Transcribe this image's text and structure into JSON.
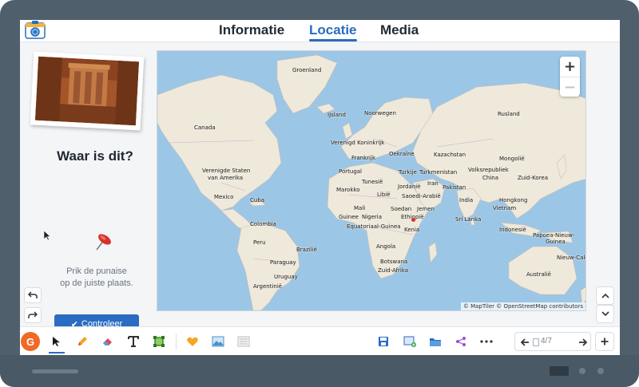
{
  "tabs": [
    {
      "label": "Informatie",
      "active": false
    },
    {
      "label": "Locatie",
      "active": true
    },
    {
      "label": "Media",
      "active": false
    }
  ],
  "question": "Waar is dit?",
  "hint_line1": "Prik de punaise",
  "hint_line2": "op de juiste plaats.",
  "check_button": "Controleer",
  "map": {
    "zoom_in": "+",
    "zoom_out": "−",
    "attribution": "© MapTiler © OpenStreetMap contributors",
    "labels": [
      "Groenland",
      "IJsland",
      "Noorwegen",
      "Rusland",
      "Canada",
      "Verenigd Koninkrijk",
      "Oekraïne",
      "Kazachstan",
      "Mongolië",
      "Frankrijk",
      "Verenigde Staten",
      "van Amerika",
      "Portugal",
      "Turkije",
      "Turkmenistan",
      "Volksrepubliek",
      "China",
      "Zuid-Korea",
      "Marokko",
      "Tunesië",
      "Jordanië",
      "Iran",
      "Pakistan",
      "Libië",
      "Saoedi-Arabië",
      "India",
      "Hongkong",
      "Mexico",
      "Cuba",
      "Mali",
      "Soedan",
      "Jemen",
      "Vietnam",
      "Guinee",
      "Nigeria",
      "Ethiopië",
      "Sri Lanka",
      "Colombia",
      "Equatoriaal-Guinea",
      "Kenia",
      "Indonesië",
      "Papoea-Nieuw-",
      "Guinea",
      "Peru",
      "Brazilië",
      "Angola",
      "Nieuw-Caledonië",
      "Paraguay",
      "Botswana",
      "Zuid-Afrika",
      "Australië",
      "Uruguay",
      "Argentinië"
    ]
  },
  "toolbar": {
    "avatar_letter": "G",
    "page_counter": "4/7"
  },
  "colors": {
    "accent": "#2a6cc1",
    "avatar": "#f06a25",
    "ocean": "#9cc6e6",
    "land": "#efe9dc"
  }
}
